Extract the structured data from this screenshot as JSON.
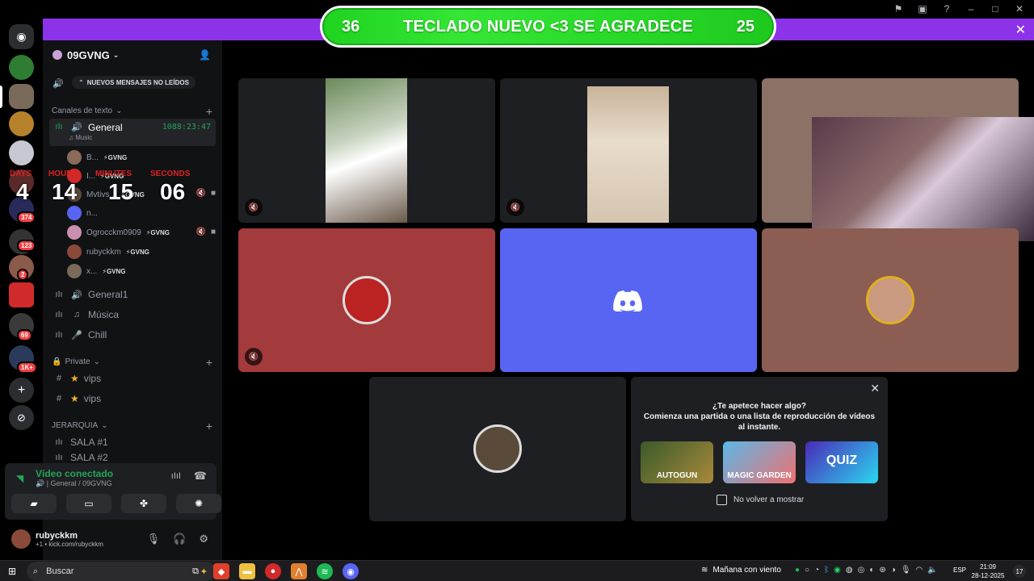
{
  "banner": {
    "left_num": "36",
    "text": "TECLADO NUEVO <3 SE AGRADECE",
    "right_num": "25"
  },
  "server": {
    "name": "09GVNG",
    "unread_label": "NUEVOS MENSAJES NO LEÍDOS"
  },
  "rail_badges": [
    "374",
    "123",
    "2",
    "69",
    "1K+"
  ],
  "categories": {
    "text": "Canales de texto",
    "private": "Private",
    "hier": "JERARQUIA"
  },
  "voice_general": {
    "name": "General",
    "time": "1088:23:47",
    "status": "Music"
  },
  "users": [
    {
      "name": "B...",
      "tag": "⚡GVNG"
    },
    {
      "name": "I...",
      "tag": "⚡GVNG"
    },
    {
      "name": "Mvtivs...",
      "tag": "⚡GVNG"
    },
    {
      "name": "n...",
      "tag": ""
    },
    {
      "name": "Ogrocckm0909",
      "tag": "⚡GVNG"
    },
    {
      "name": "rubyckkm",
      "tag": "⚡GVNG"
    },
    {
      "name": "x...",
      "tag": "⚡GVNG"
    }
  ],
  "timer": {
    "days_label": "DAYS",
    "days": "4",
    "hours_label": "HOURS",
    "hours": "14",
    "minutes_label": "MINUTES",
    "minutes": "15",
    "seconds_label": "SECONDS",
    "seconds": "06"
  },
  "channels": {
    "general1": "General",
    "musica": "Música",
    "chill": "Chill",
    "vips1": "vips",
    "vips2": "vips",
    "sala1": "SALA #1",
    "sala2": "SALA #2"
  },
  "voice_connected": {
    "title": "Vídeo conectado",
    "sub": "General / 09GVNG"
  },
  "user_panel": {
    "name": "rubyckkm",
    "status": "+1 • kick.com/rubyckkm"
  },
  "activity": {
    "title": "¿Te apetece hacer algo?",
    "line2": "Comienza una partida o una lista de reproducción de vídeos",
    "line3": "al instante.",
    "games": [
      "AUTOGUN",
      "MAGIC GARDEN",
      "QUIZ"
    ],
    "checkbox_label": "No volver a mostrar"
  },
  "taskbar": {
    "search": "Buscar",
    "weather": "Mañana con viento",
    "lang": "ESP",
    "time": "21:09",
    "date": "28-12-2025"
  },
  "colors": {
    "accent": "#8c33ea",
    "banner_green": "#28d828",
    "tile_red": "#a33a3c",
    "tile_blurple": "#5865f2",
    "tile_brown": "#8c5d53"
  }
}
